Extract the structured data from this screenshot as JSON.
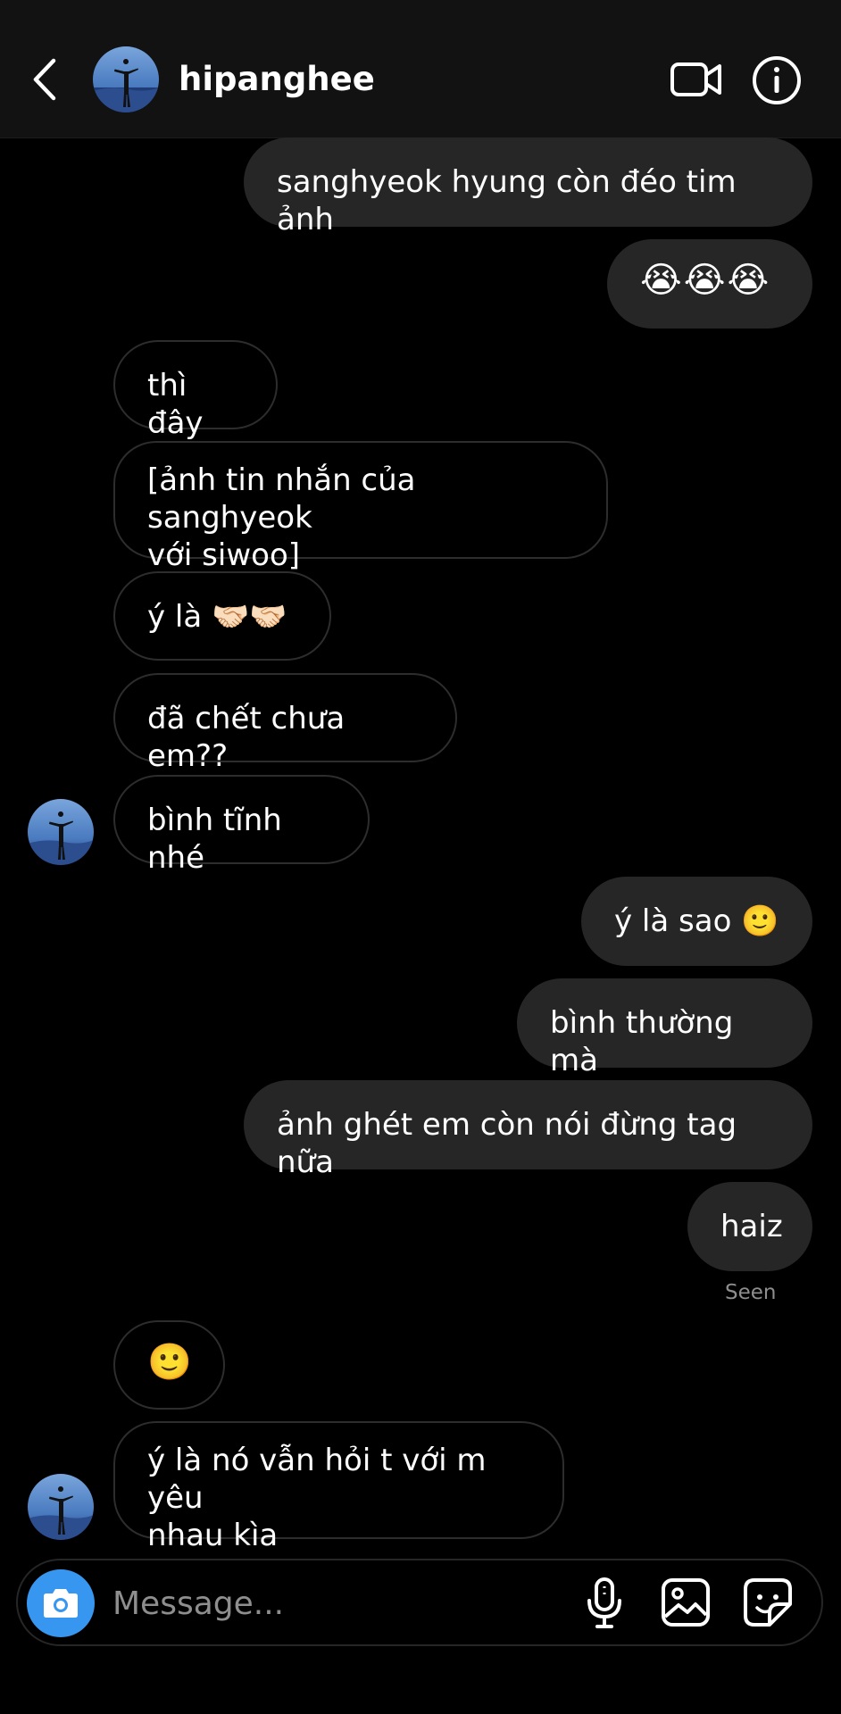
{
  "header": {
    "username": "hipanghee"
  },
  "messages": [
    {
      "text": "sanghyeok hyung còn đéo tim ảnh"
    },
    {
      "text": "😭😭😭"
    },
    {
      "text": "thì đây"
    },
    {
      "text": "[ảnh tin nhắn của sanghyeok\nvới siwoo]"
    },
    {
      "text": "ý là 🤝🏻🤝🏻"
    },
    {
      "text": "đã chết chưa em??"
    },
    {
      "text": "bình tĩnh nhé"
    },
    {
      "text": "ý là sao 🙂"
    },
    {
      "text": "bình thường mà"
    },
    {
      "text": "ảnh ghét em còn nói đừng tag nữa"
    },
    {
      "text": "haiz"
    },
    {
      "text": "🙂"
    },
    {
      "text": "ý là nó vẫn hỏi t với m yêu\nnhau kìa"
    }
  ],
  "seen_label": "Seen",
  "composer": {
    "placeholder": "Message..."
  },
  "icons": [
    "back-chevron-icon",
    "video-call-icon",
    "info-icon",
    "camera-icon",
    "microphone-icon",
    "gallery-icon",
    "sticker-icon"
  ],
  "colors": {
    "background": "#000000",
    "header": "#121212",
    "outgoing_bubble": "#262626",
    "incoming_border": "#2d2d2d",
    "camera_button": "#3797f0",
    "muted_text": "#8e8e8e"
  }
}
